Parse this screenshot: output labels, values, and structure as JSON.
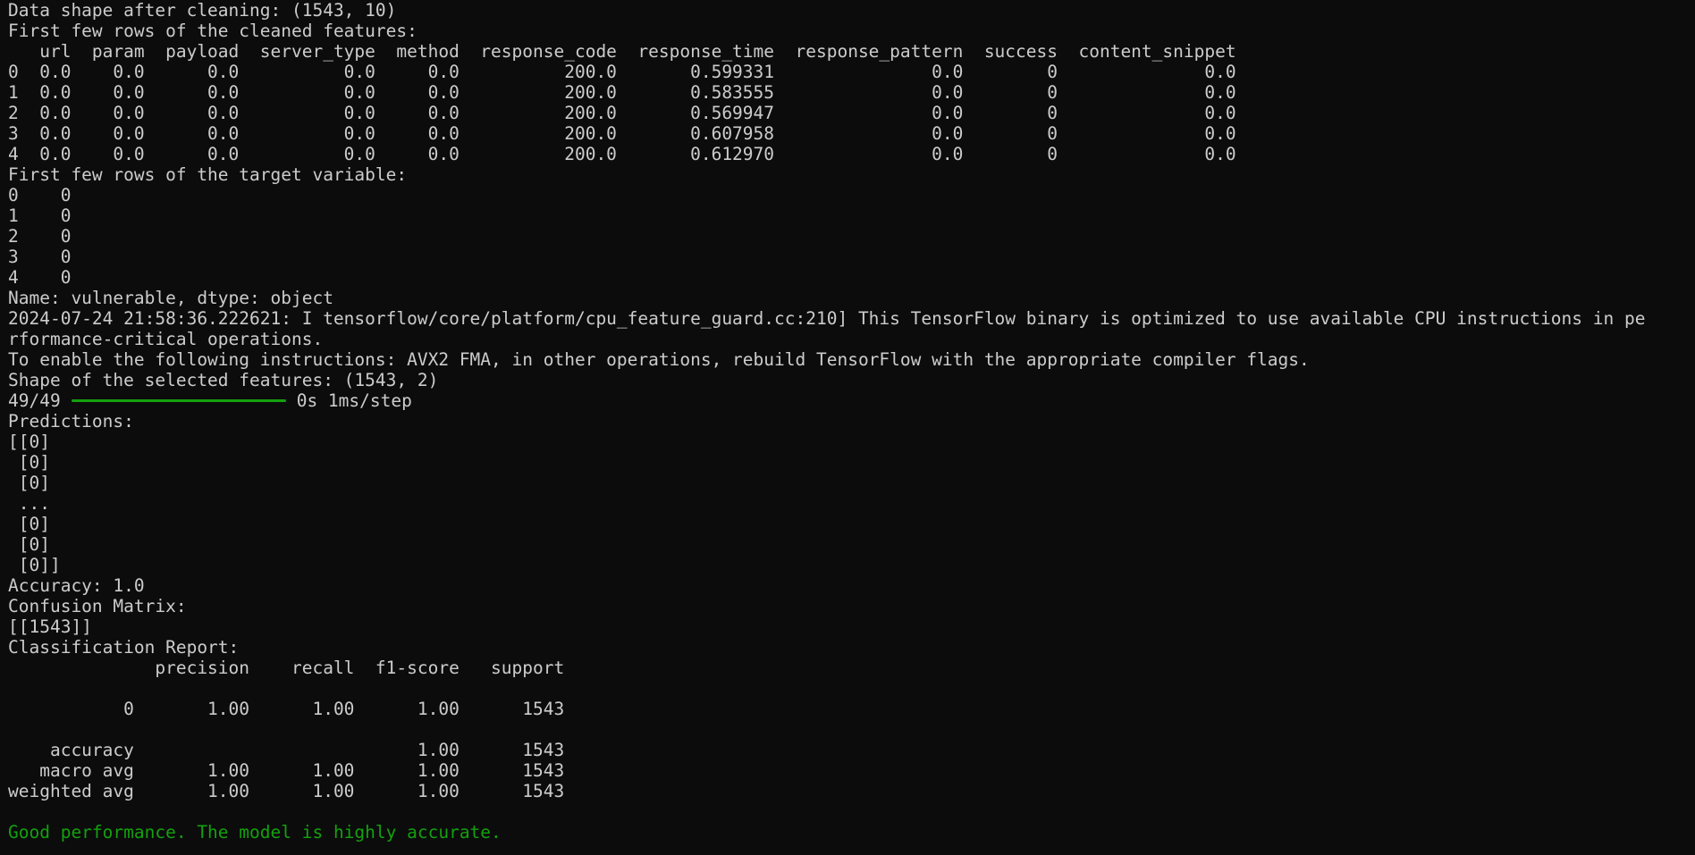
{
  "colors": {
    "background": "#0c0c0c",
    "text": "#cccccc",
    "success_text": "#13a10e",
    "progress_bar": "#13a10e"
  },
  "terminal": {
    "lines_before_progress": [
      "Data shape after cleaning: (1543, 10)",
      "First few rows of the cleaned features:",
      "   url  param  payload  server_type  method  response_code  response_time  response_pattern  success  content_snippet",
      "0  0.0    0.0      0.0          0.0     0.0          200.0       0.599331               0.0        0              0.0",
      "1  0.0    0.0      0.0          0.0     0.0          200.0       0.583555               0.0        0              0.0",
      "2  0.0    0.0      0.0          0.0     0.0          200.0       0.569947               0.0        0              0.0",
      "3  0.0    0.0      0.0          0.0     0.0          200.0       0.607958               0.0        0              0.0",
      "4  0.0    0.0      0.0          0.0     0.0          200.0       0.612970               0.0        0              0.0",
      "First few rows of the target variable:",
      "0    0",
      "1    0",
      "2    0",
      "3    0",
      "4    0",
      "Name: vulnerable, dtype: object",
      "2024-07-24 21:58:36.222621: I tensorflow/core/platform/cpu_feature_guard.cc:210] This TensorFlow binary is optimized to use available CPU instructions in pe",
      "rformance-critical operations.",
      "To enable the following instructions: AVX2 FMA, in other operations, rebuild TensorFlow with the appropriate compiler flags.",
      "Shape of the selected features: (1543, 2)"
    ],
    "progress": {
      "count": "49/49",
      "fraction": 1.0,
      "timing": "0s 1ms/step"
    },
    "lines_after_progress": [
      "Predictions:",
      "[[0]",
      " [0]",
      " [0]",
      " ...",
      " [0]",
      " [0]",
      " [0]]",
      "Accuracy: 1.0",
      "Confusion Matrix:",
      "[[1543]]",
      "Classification Report:",
      "              precision    recall  f1-score   support",
      "",
      "           0       1.00      1.00      1.00      1543",
      "",
      "    accuracy                           1.00      1543",
      "   macro avg       1.00      1.00      1.00      1543",
      "weighted avg       1.00      1.00      1.00      1543",
      ""
    ],
    "final_message": "Good performance. The model is highly accurate."
  }
}
